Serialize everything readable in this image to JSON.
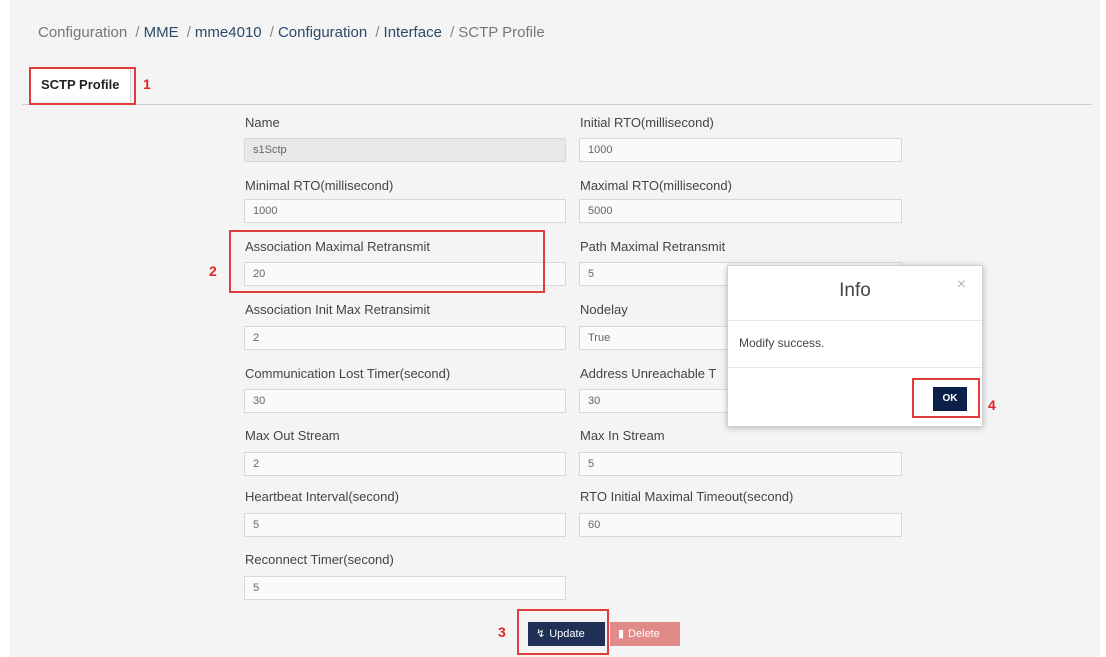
{
  "breadcrumb": {
    "items": [
      "Configuration",
      "MME",
      "mme4010",
      "Configuration",
      "Interface",
      "SCTP Profile"
    ],
    "separator": "/"
  },
  "tabs": [
    {
      "label": "SCTP Profile"
    }
  ],
  "annotations": [
    "1",
    "2",
    "3",
    "4"
  ],
  "fields": {
    "name": {
      "label": "Name",
      "value": "s1Sctp"
    },
    "initial_rto": {
      "label": "Initial RTO(millisecond)",
      "value": "1000"
    },
    "minimal_rto": {
      "label": "Minimal RTO(millisecond)",
      "value": "1000"
    },
    "maximal_rto": {
      "label": "Maximal RTO(millisecond)",
      "value": "5000"
    },
    "assoc_max_retransmit": {
      "label": "Association Maximal Retransmit",
      "value": "20"
    },
    "path_max_retransmit": {
      "label": "Path Maximal Retransmit",
      "value": "5"
    },
    "assoc_init_max_retransmit": {
      "label": "Association Init Max Retransimit",
      "value": "2"
    },
    "nodelay": {
      "label": "Nodelay",
      "value": "True"
    },
    "comm_lost_timer": {
      "label": "Communication Lost Timer(second)",
      "value": "30"
    },
    "addr_unreachable": {
      "label": "Address Unreachable T",
      "value": "30"
    },
    "max_out_stream": {
      "label": "Max Out Stream",
      "value": "2"
    },
    "max_in_stream": {
      "label": "Max In Stream",
      "value": "5"
    },
    "heartbeat_interval": {
      "label": "Heartbeat Interval(second)",
      "value": "5"
    },
    "rto_init_max_timeout": {
      "label": "RTO Initial Maximal Timeout(second)",
      "value": "60"
    },
    "reconnect_timer": {
      "label": "Reconnect Timer(second)",
      "value": "5"
    }
  },
  "buttons": {
    "update": "Update",
    "delete": "Delete"
  },
  "modal": {
    "title": "Info",
    "close": "×",
    "message": "Modify success.",
    "ok": "OK"
  },
  "colors": {
    "primary": "#1f2f56",
    "danger": "#e18a8a",
    "highlight": "#e23b3b",
    "ok_button": "#0b1f4b"
  },
  "icons": {
    "update": "upload-icon",
    "delete": "trash-icon",
    "close": "close-icon"
  }
}
